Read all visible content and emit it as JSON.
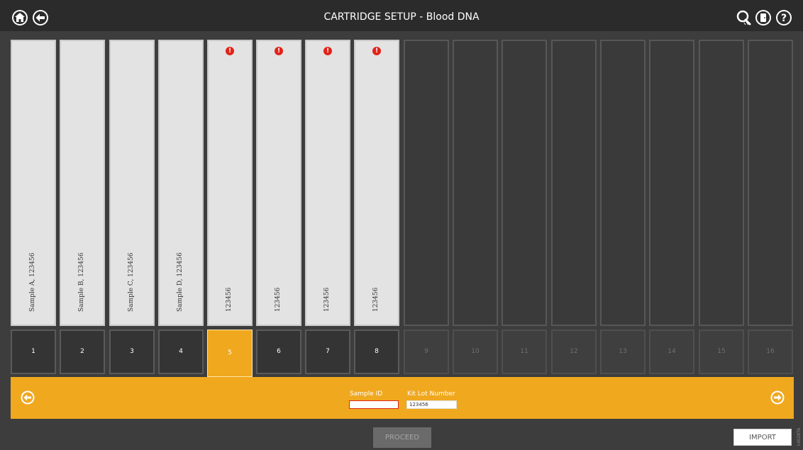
{
  "header": {
    "title": "CARTRIDGE SETUP - Blood DNA",
    "icons": [
      "home-icon",
      "back-icon",
      "search-refresh-icon",
      "door-exit-icon",
      "help-icon"
    ]
  },
  "slots": [
    {
      "label": "Sample A, 123456",
      "alert": false,
      "filled": true
    },
    {
      "label": "Sample B, 123456",
      "alert": false,
      "filled": true
    },
    {
      "label": "Sample C, 123456",
      "alert": false,
      "filled": true
    },
    {
      "label": "Sample D, 123456",
      "alert": false,
      "filled": true
    },
    {
      "label": "123456",
      "alert": true,
      "filled": true
    },
    {
      "label": "123456",
      "alert": true,
      "filled": true
    },
    {
      "label": "123456",
      "alert": true,
      "filled": true
    },
    {
      "label": "123456",
      "alert": true,
      "filled": true
    },
    {
      "label": "",
      "alert": false,
      "filled": false
    },
    {
      "label": "",
      "alert": false,
      "filled": false
    },
    {
      "label": "",
      "alert": false,
      "filled": false
    },
    {
      "label": "",
      "alert": false,
      "filled": false
    },
    {
      "label": "",
      "alert": false,
      "filled": false
    },
    {
      "label": "",
      "alert": false,
      "filled": false
    },
    {
      "label": "",
      "alert": false,
      "filled": false
    },
    {
      "label": "",
      "alert": false,
      "filled": false
    }
  ],
  "alert_glyph": "!",
  "position_numbers": [
    "1",
    "2",
    "3",
    "4",
    "5",
    "6",
    "7",
    "8",
    "9",
    "10",
    "11",
    "12",
    "13",
    "14",
    "15",
    "16"
  ],
  "active_position": "5",
  "panel": {
    "sample_id_label": "Sample ID",
    "sample_id_value": "",
    "kit_lot_label": "Kit Lot Number",
    "kit_lot_value": "123456"
  },
  "footer": {
    "proceed_label": "PROCEED",
    "import_label": "IMPORT",
    "figure_code": "14028TA"
  },
  "colors": {
    "accent": "#f0a81f",
    "alert": "#e2231a",
    "background": "#3d3d3d",
    "header": "#2b2b2b"
  }
}
